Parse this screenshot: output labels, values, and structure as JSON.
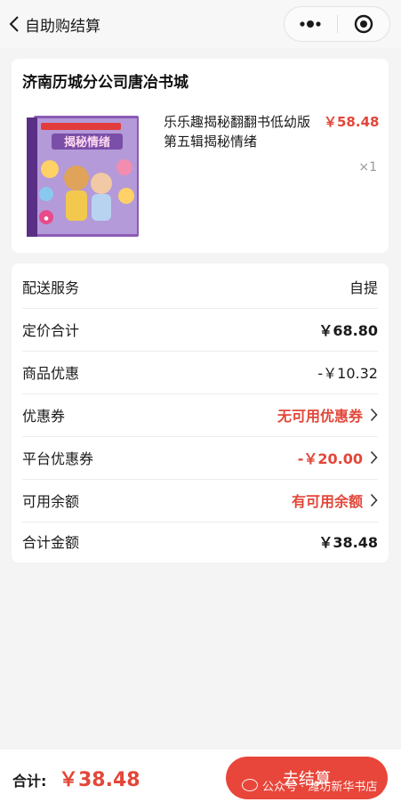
{
  "nav": {
    "title": "自助购结算"
  },
  "store": {
    "name": "济南历城分公司唐冶书城"
  },
  "product": {
    "title": "乐乐趣揭秘翻翻书低幼版第五辑揭秘情绪",
    "price": "￥58.48",
    "quantity": "×1",
    "cover_title": "揭秘情绪",
    "cover_colors": {
      "background": "#7a4fa8",
      "title_red": "#e23c3c",
      "badge": "#e84a8a"
    }
  },
  "summary": {
    "rows": [
      {
        "label": "配送服务",
        "value": "自提",
        "style": "normal",
        "chevron": false
      },
      {
        "label": "定价合计",
        "value": "￥68.80",
        "style": "bold",
        "chevron": false
      },
      {
        "label": "商品优惠",
        "value": "-￥10.32",
        "style": "normal",
        "chevron": false
      },
      {
        "label": "优惠券",
        "value": "无可用优惠券",
        "style": "red",
        "chevron": true
      },
      {
        "label": "平台优惠券",
        "value": "-￥20.00",
        "style": "red",
        "chevron": true
      },
      {
        "label": "可用余额",
        "value": "有可用余额",
        "style": "red",
        "chevron": true
      },
      {
        "label": "合计金额",
        "value": "￥38.48",
        "style": "bold",
        "chevron": false
      }
    ]
  },
  "footer": {
    "total_label": "合计:",
    "total_amount": "￥38.48",
    "checkout_label": "去结算",
    "watermark": "公众号 · 潍坊新华书店"
  },
  "colors": {
    "accent_red": "#e2473a",
    "button_red": "#e8463a",
    "page_bg": "#f4f4f4"
  }
}
